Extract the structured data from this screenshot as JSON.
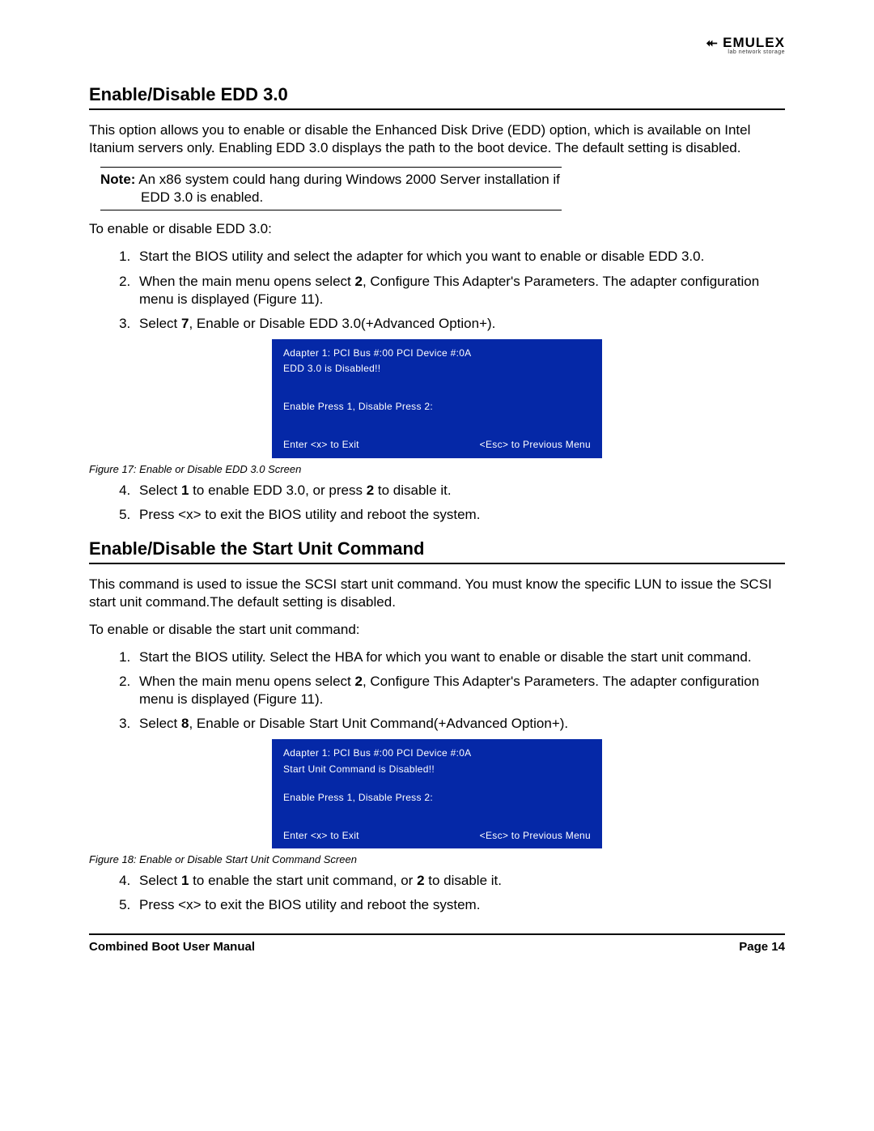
{
  "logo": {
    "main": "⯬ EMULEX",
    "sub": "lab network storage"
  },
  "section1": {
    "heading": "Enable/Disable EDD 3.0",
    "intro": "This option allows you to enable or disable the Enhanced Disk Drive (EDD) option, which is available on Intel Itanium servers only. Enabling EDD 3.0 displays the path to the boot device. The default setting is disabled.",
    "note_label": "Note:",
    "note_text": " An x86 system could hang during Windows 2000 Server installation if EDD 3.0 is enabled.",
    "lead": "To enable or disable EDD 3.0:",
    "step1": "Start the BIOS utility and select the adapter for which you want to enable or disable EDD 3.0.",
    "step2a": "When the main menu opens select ",
    "step2b": "2",
    "step2c": ", Configure This Adapter's Parameters. The adapter configuration menu is displayed (Figure 11).",
    "step3a": "Select ",
    "step3b": "7",
    "step3c": ", Enable or Disable EDD 3.0(+Advanced Option+).",
    "step4a": "Select ",
    "step4b": "1",
    "step4c": " to enable EDD 3.0, or press ",
    "step4d": "2",
    "step4e": " to disable it.",
    "step5": "Press <x> to exit the BIOS utility and reboot the system.",
    "bios": {
      "line1": "Adapter 1: PCI Bus #:00 PCI Device #:0A",
      "line2": "EDD 3.0 is Disabled!!",
      "line3": "Enable Press 1,  Disable Press 2:",
      "foot_left": "Enter <x> to Exit",
      "foot_right": "<Esc> to Previous Menu"
    },
    "fig_caption": "Figure 17: Enable or Disable EDD 3.0 Screen"
  },
  "section2": {
    "heading": "Enable/Disable the Start Unit Command",
    "intro": "This command is used to issue the SCSI start unit command. You must know the specific LUN to issue the SCSI start unit command.The default setting is disabled.",
    "lead": "To enable or disable the start unit command:",
    "step1": "Start the BIOS utility. Select the HBA for which you want to enable or disable the start unit command.",
    "step2a": "When the main menu opens select ",
    "step2b": "2",
    "step2c": ", Configure This Adapter's Parameters. The adapter configuration menu is displayed (Figure 11).",
    "step3a": "Select ",
    "step3b": "8",
    "step3c": ", Enable or Disable Start Unit Command(+Advanced Option+).",
    "step4a": "Select ",
    "step4b": "1",
    "step4c": " to enable the start unit command, or ",
    "step4d": "2",
    "step4e": " to disable it.",
    "step5": "Press <x> to exit the BIOS utility and reboot the system.",
    "bios": {
      "line1": "Adapter 1: PCI Bus #:00 PCI Device #:0A",
      "line2": "Start Unit Command is Disabled!!",
      "line3": "Enable Press 1,  Disable Press 2:",
      "foot_left": "Enter <x> to Exit",
      "foot_right": "<Esc> to Previous Menu"
    },
    "fig_caption": "Figure 18: Enable or Disable Start Unit Command Screen"
  },
  "footer": {
    "left": "Combined Boot User Manual",
    "right": "Page 14"
  }
}
